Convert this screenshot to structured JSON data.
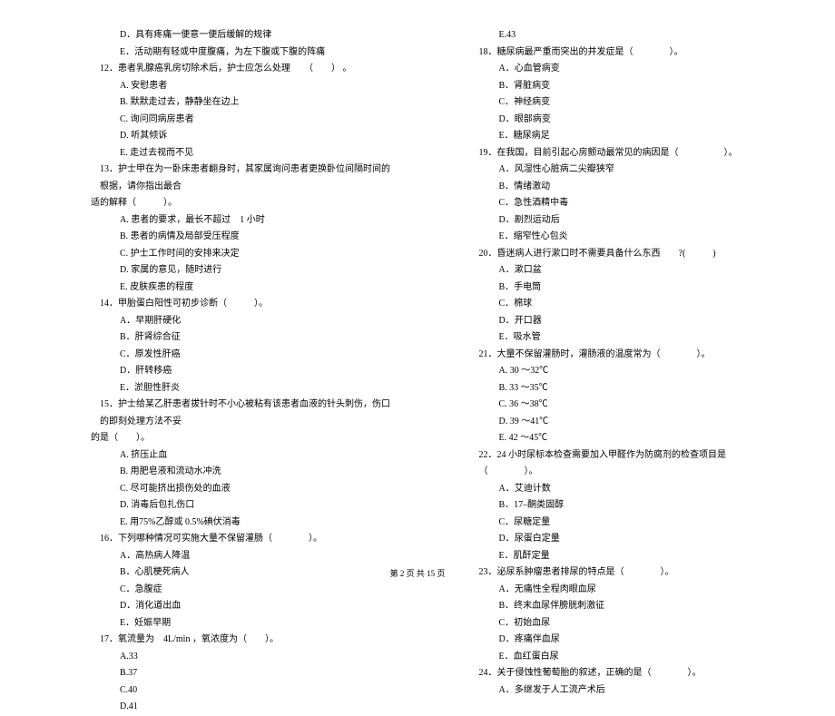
{
  "left_column": [
    {
      "cls": "option",
      "text": "D．具有疼痛一便意一便后缓解的规律"
    },
    {
      "cls": "option",
      "text": "E．活动期有轻或中度腹痛，为左下腹或下腹的阵痛"
    },
    {
      "cls": "question",
      "text": "12．患者乳腺癌乳房切除术后，护士应怎么处理　　（　　） 。"
    },
    {
      "cls": "option",
      "text": "A. 安慰患者"
    },
    {
      "cls": "option",
      "text": "B. 默默走过去，静静坐在边上"
    },
    {
      "cls": "option",
      "text": "C. 询问同病房患者"
    },
    {
      "cls": "option",
      "text": "D. 听其倾诉"
    },
    {
      "cls": "option",
      "text": "E. 走过去视而不见"
    },
    {
      "cls": "question",
      "text": "13．护士甲在为一卧床患者翻身时，其家属询问患者更换卧位间隔时间的根据，请你指出最合"
    },
    {
      "cls": "continuation",
      "text": "适的解释（　　　）。"
    },
    {
      "cls": "option",
      "text": "A. 患者的要求，最长不超过　1 小时"
    },
    {
      "cls": "option",
      "text": "B. 患者的病情及局部受压程度"
    },
    {
      "cls": "option",
      "text": "C. 护士工作时间的安排来决定"
    },
    {
      "cls": "option",
      "text": "D. 家属的意见，随时进行"
    },
    {
      "cls": "option",
      "text": "E. 皮肤疾患的程度"
    },
    {
      "cls": "question",
      "text": "14．甲胎蛋白阳性可初步诊断（　　　）。"
    },
    {
      "cls": "option",
      "text": "A．早期肝硬化"
    },
    {
      "cls": "option",
      "text": "B．肝肾综合征"
    },
    {
      "cls": "option",
      "text": "C．原发性肝癌"
    },
    {
      "cls": "option",
      "text": "D．肝转移癌"
    },
    {
      "cls": "option",
      "text": "E．淤胆性肝炎"
    },
    {
      "cls": "question",
      "text": "15．护士给某乙肝患者拔针时不小心被粘有该患者血液的针头刺伤，伤口的即刻处理方法不妥"
    },
    {
      "cls": "continuation",
      "text": "的是（　　）。"
    },
    {
      "cls": "option",
      "text": "A. 挤压止血"
    },
    {
      "cls": "option",
      "text": "B. 用肥皂液和流动水冲洗"
    },
    {
      "cls": "option",
      "text": "C. 尽可能挤出损伤处的血液"
    },
    {
      "cls": "option",
      "text": "D. 消毒后包扎伤口"
    },
    {
      "cls": "option",
      "text": "E. 用75%乙醇或 0.5%碘伏消毒"
    },
    {
      "cls": "question",
      "text": "16．下列哪种情况可实施大量不保留灌肠（　　　　）。"
    },
    {
      "cls": "option",
      "text": "A．高热病人降温"
    },
    {
      "cls": "option",
      "text": "B．心肌梗死病人"
    },
    {
      "cls": "option",
      "text": "C．急腹症"
    },
    {
      "cls": "option",
      "text": "D．消化道出血"
    },
    {
      "cls": "option",
      "text": "E．妊娠早期"
    },
    {
      "cls": "question",
      "text": "17．氧流量为　4L/min ，氧浓度为（　　）。"
    },
    {
      "cls": "option",
      "text": "A.33"
    },
    {
      "cls": "option",
      "text": "B.37"
    },
    {
      "cls": "option",
      "text": "C.40"
    },
    {
      "cls": "option",
      "text": "D.41"
    }
  ],
  "right_column": [
    {
      "cls": "option",
      "text": "E.43"
    },
    {
      "cls": "question",
      "text": "18．糖尿病最严重而突出的并发症是（　　　　）。"
    },
    {
      "cls": "option",
      "text": "A．心血管病变"
    },
    {
      "cls": "option",
      "text": "B．肾脏病变"
    },
    {
      "cls": "option",
      "text": "C．神经病变"
    },
    {
      "cls": "option",
      "text": "D．眼部病变"
    },
    {
      "cls": "option",
      "text": "E．糖尿病足"
    },
    {
      "cls": "question",
      "text": "19．在我国，目前引起心房颤动最常见的病因是（　　　　　）。"
    },
    {
      "cls": "option",
      "text": "A．风湿性心脏病二尖瓣狭窄"
    },
    {
      "cls": "option",
      "text": "B．情绪激动"
    },
    {
      "cls": "option",
      "text": "C．急性酒精中毒"
    },
    {
      "cls": "option",
      "text": "D．剧烈运动后"
    },
    {
      "cls": "option",
      "text": "E．缩窄性心包炎"
    },
    {
      "cls": "question",
      "text": "20．昏迷病人进行漱口时不需要具备什么东西　　?(　　　)"
    },
    {
      "cls": "option",
      "text": "A．漱口盆"
    },
    {
      "cls": "option",
      "text": "B．手电筒"
    },
    {
      "cls": "option",
      "text": "C．棉球"
    },
    {
      "cls": "option",
      "text": "D．开口器"
    },
    {
      "cls": "option",
      "text": "E．吸水管"
    },
    {
      "cls": "question",
      "text": "21．大量不保留灌肠时，灌肠液的温度常为（　　　　）。"
    },
    {
      "cls": "option",
      "text": "A. 30 ～32℃"
    },
    {
      "cls": "option",
      "text": "B. 33 ～35℃"
    },
    {
      "cls": "option",
      "text": "C. 36 ～38℃"
    },
    {
      "cls": "option",
      "text": "D. 39 ～41℃"
    },
    {
      "cls": "option",
      "text": "E. 42 ～45℃"
    },
    {
      "cls": "question",
      "text": "22．24 小时尿标本检查需要加入甲醛作为防腐剂的检查项目是（　　　　）。"
    },
    {
      "cls": "option",
      "text": "A．艾迪计数"
    },
    {
      "cls": "option",
      "text": "B．17–酮类固醇"
    },
    {
      "cls": "option",
      "text": "C．尿糖定量"
    },
    {
      "cls": "option",
      "text": "D．尿蛋白定量"
    },
    {
      "cls": "option",
      "text": "E．肌酐定量"
    },
    {
      "cls": "question",
      "text": "23．泌尿系肿瘤患者排尿的特点是（　　　　）。"
    },
    {
      "cls": "option",
      "text": "A．无痛性全程肉眼血尿"
    },
    {
      "cls": "option",
      "text": "B．终末血尿伴膀胱刺激征"
    },
    {
      "cls": "option",
      "text": "C．初始血尿"
    },
    {
      "cls": "option",
      "text": "D．疼痛伴血尿"
    },
    {
      "cls": "option",
      "text": "E．血红蛋白尿"
    },
    {
      "cls": "question",
      "text": "24．关于侵蚀性葡萄胎的叙述，正确的是（　　　　）。"
    },
    {
      "cls": "option",
      "text": "A．多继发于人工流产术后"
    }
  ],
  "footer": "第 2 页 共 15 页"
}
